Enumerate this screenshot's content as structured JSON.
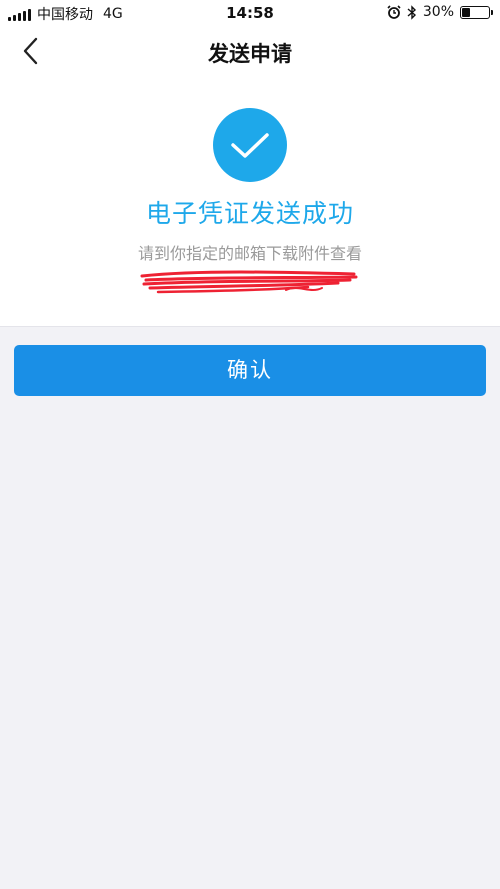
{
  "status_bar": {
    "carrier": "中国移动",
    "network": "4G",
    "time": "14:58",
    "battery": "30%",
    "battery_level": 0.3
  },
  "nav": {
    "title": "发送申请",
    "back_icon": "chevron-left-icon"
  },
  "result": {
    "icon": "check-icon",
    "icon_color": "#1ea8ea",
    "title": "电子凭证发送成功",
    "subtitle": "请到你指定的邮箱下载附件查看"
  },
  "actions": {
    "confirm_label": "确认",
    "confirm_color": "#1a8fe6"
  }
}
